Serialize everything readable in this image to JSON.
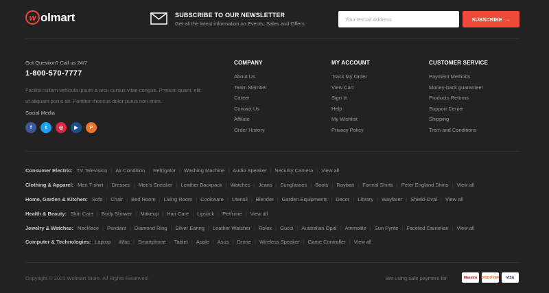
{
  "brand": {
    "logo_mark": "w",
    "logo_text": "olmart"
  },
  "newsletter": {
    "title": "SUBSCRIBE TO  OUR NEWSLETTER",
    "subtitle": "Get all the latest information on Events, Sales and Offers.",
    "placeholder": "Your E-mail Address",
    "button_label": "SUBSCRIBE",
    "button_arrow": "→"
  },
  "contact": {
    "question": "Got Question? Call us 24/7",
    "phone": "1-800-570-7777",
    "about": "Facilisi nullam vehicula ipsum a arcu cursus vitae congue. Pretium quam, elit ut aliquam purus sit. Porttitor rhoncus dolor purus non enim.",
    "social_label": "Social Media",
    "socials": [
      {
        "name": "facebook-icon",
        "glyph": "f",
        "color": "#3b5998"
      },
      {
        "name": "twitter-icon",
        "glyph": "t",
        "color": "#1da1f2"
      },
      {
        "name": "instagram-icon",
        "glyph": "◎",
        "color": "#dc2743"
      },
      {
        "name": "youtube-icon",
        "glyph": "▶",
        "color": "#1e4f8c"
      },
      {
        "name": "pinterest-icon",
        "glyph": "P",
        "color": "#e8732a"
      }
    ]
  },
  "columns": [
    {
      "title": "COMPANY",
      "items": [
        "About Us",
        "Team Member",
        "Career",
        "Contact Us",
        "Affilate",
        "Order History"
      ]
    },
    {
      "title": "MY ACCOUNT",
      "items": [
        "Track My Order",
        "View Cart",
        "Sign In",
        "Help",
        "My Wishlist",
        "Privacy Policy"
      ]
    },
    {
      "title": "CUSTOMER SERVICE",
      "items": [
        "Payment Methods",
        "Money-back guarantee!",
        "Products Returns",
        "Support Center",
        "Shipping",
        "Trem and Conditions"
      ]
    }
  ],
  "tag_rows": [
    {
      "category": "Consumer Electric:",
      "tags": [
        "TV Television",
        "Air Condition",
        "Refrigator",
        "Washing Machine",
        "Audio Speaker",
        "Security Camera",
        "View  all"
      ]
    },
    {
      "category": "Clothing & Apparel:",
      "tags": [
        "Men T-shirt",
        "Dresses",
        "Men's Sneaker",
        "Leather Backpack",
        "Watches",
        "Jeans",
        "Sunglasses",
        "Boots",
        "Rayban",
        "Formal Shirts",
        "Peter England Shirts",
        "View all"
      ]
    },
    {
      "category": "Home, Garden & Kitchen:",
      "tags": [
        "Sofa",
        "Chair",
        "Bed Room",
        "Living Room",
        "Cookware",
        "Utensil",
        "Blender",
        "Garden Equipments",
        "Decor",
        "Library",
        "Wayfarer",
        "Shield-Oval",
        "View all"
      ]
    },
    {
      "category": "Health & Beauty:",
      "tags": [
        "Skin Care",
        "Body Shower",
        "Makeup",
        "Hair Care",
        "Lipstick",
        "Perfume",
        "View all"
      ]
    },
    {
      "category": "Jewelry & Watches:",
      "tags": [
        "Necklace",
        "Pendant",
        "Diamond Ring",
        "Silver Earing",
        "Leather Watcher",
        "Rolex",
        "Gucci",
        "Australian Opal",
        "Ammolite",
        "Sun Pyrite",
        "Faceted Carnelian",
        "View all"
      ]
    },
    {
      "category": "Computer & Technologies:",
      "tags": [
        "Laptop",
        "iMac",
        "Smartphone",
        "Tablet",
        "Apple",
        "Asus",
        "Drone",
        "Wireless Speaker",
        "Game Controller",
        "View all"
      ]
    }
  ],
  "bottom": {
    "copyright": "Copyright © 2021 Wolmart Store. All Rights Reserved.",
    "payment_label": "We using safe payment for",
    "cards": [
      {
        "name": "maestro-card-icon",
        "label": "Maestro",
        "color": "#cc0000"
      },
      {
        "name": "discover-card-icon",
        "label": "DISCOVER",
        "color": "#e8732a"
      },
      {
        "name": "visa-card-icon",
        "label": "VISA",
        "color": "#1a1f71"
      }
    ]
  }
}
